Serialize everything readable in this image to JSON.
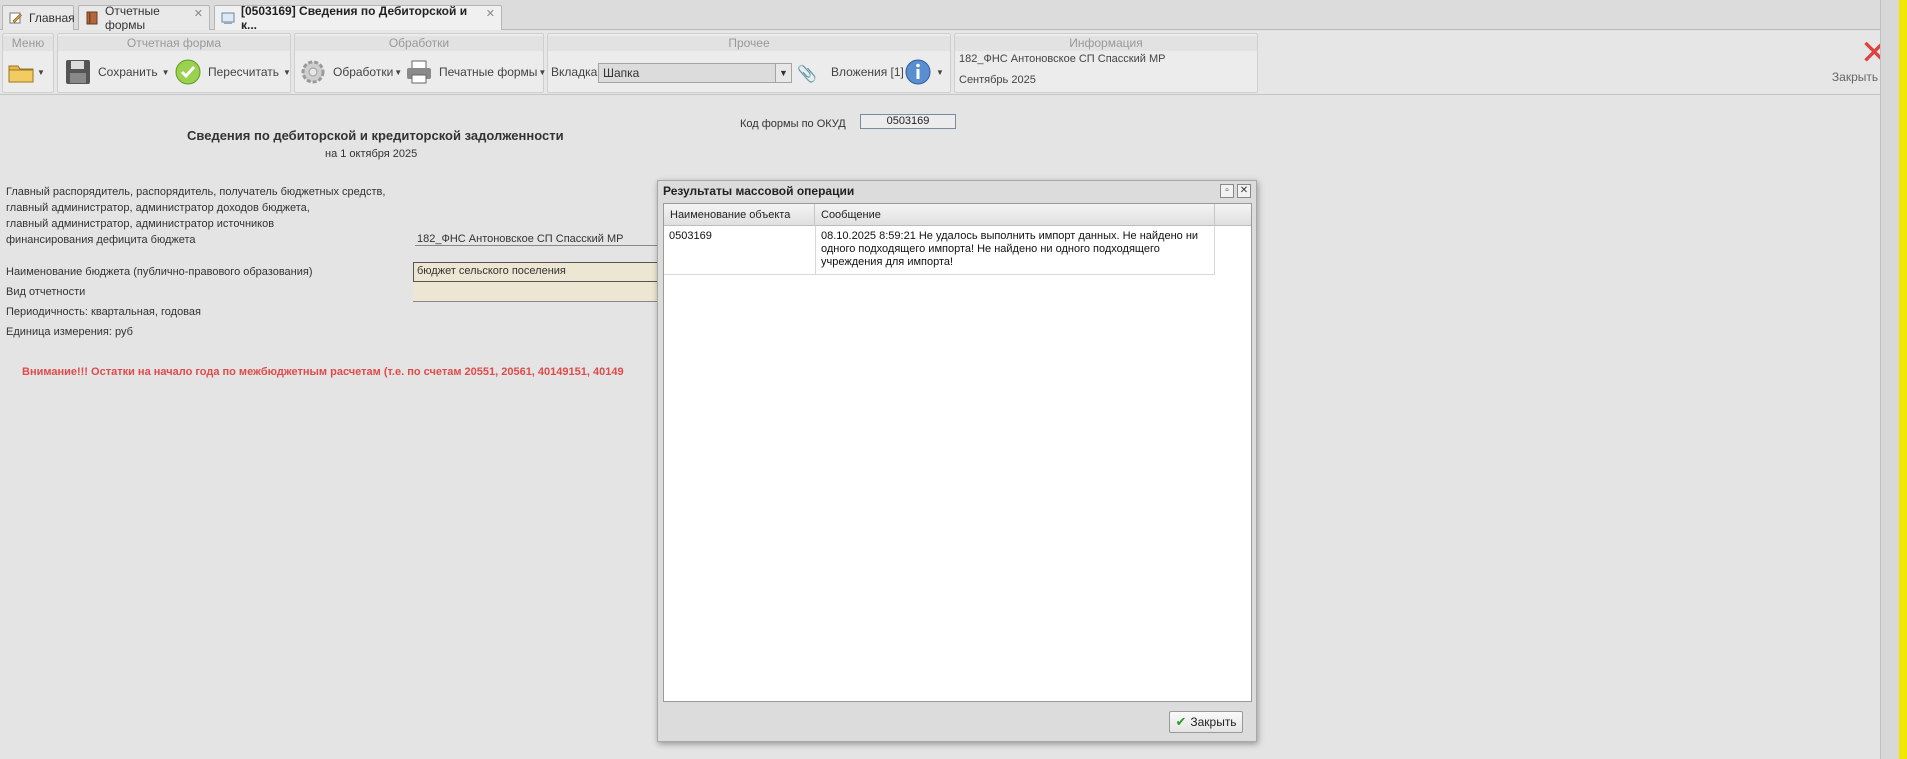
{
  "tabs": [
    {
      "label": "Главная",
      "icon": "edit-icon"
    },
    {
      "label": "Отчетные формы",
      "icon": "book-icon"
    },
    {
      "label": "[0503169] Сведения по Дебиторской и к...",
      "icon": "form-icon"
    }
  ],
  "toolbar": {
    "groups": {
      "menu": "Меню",
      "report_form": "Отчетная форма",
      "processing": "Обработки",
      "other": "Прочее",
      "info": "Информация"
    },
    "save": "Сохранить",
    "recalc": "Пересчитать",
    "processing_btn": "Обработки",
    "print_forms": "Печатные формы",
    "tab_label": "Вкладка",
    "tab_value": "Шапка",
    "attachments": "Вложения [1]",
    "info_line1": "182_ФНС Антоновское СП Спасский МР",
    "info_line2": "Сентябрь 2025",
    "close": "Закрыть"
  },
  "form": {
    "title": "Сведения по дебиторской и кредиторской задолженности",
    "subtitle": "на 1 октября 2025",
    "okud_label": "Код формы по ОКУД",
    "okud_value": "0503169",
    "org_label_1": "Главный распорядитель, распорядитель, получатель бюджетных средств,",
    "org_label_2": "главный администратор, администратор доходов бюджета,",
    "org_label_3": "главный администратор, администратор источников",
    "org_label_4": "финансирования дефицита бюджета",
    "org_value": "182_ФНС Антоновское СП Спасский МР",
    "budget_label": "Наименование бюджета (публично-правового образования)",
    "budget_value": "бюджет сельского поселения",
    "report_type_label": "Вид отчетности",
    "period_label": "Периодичность: квартальная, годовая",
    "unit_label": "Единица измерения: руб",
    "warning": "Внимание!!! Остатки на начало года по межбюджетным расчетам (т.е. по счетам 20551, 20561, 40149151, 40149"
  },
  "dialog": {
    "title": "Результаты массовой операции",
    "columns": [
      "Наименование объекта",
      "Сообщение"
    ],
    "rows": [
      {
        "object": "0503169",
        "message_1": "08.10.2025 8:59:21 Не удалось выполнить импорт данных. Не найдено ни",
        "message_2": "одного подходящего импорта! Не найдено ни одного подходящего",
        "message_3": "учреждения для импорта!"
      }
    ],
    "close_button": "Закрыть"
  }
}
